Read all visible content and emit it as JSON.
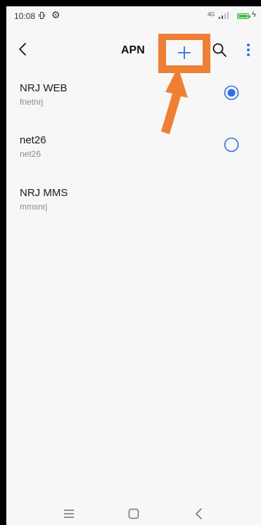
{
  "status_bar": {
    "time": "10:08",
    "network": "4G",
    "icons": [
      "vibrate-icon",
      "gear-icon",
      "signal-icon",
      "battery-icon",
      "charging-icon"
    ],
    "battery_color": "#37c43a"
  },
  "toolbar": {
    "title": "APN",
    "back_icon": "chevron-left-icon",
    "add_icon": "plus-icon",
    "search_icon": "search-icon",
    "more_icon": "more-vertical-icon",
    "highlight_color": "#ef7f35",
    "accent_color": "#2f6fe0"
  },
  "apns": [
    {
      "name": "NRJ WEB",
      "apn": "fnetnrj",
      "radio": "selected"
    },
    {
      "name": "net26",
      "apn": "net26",
      "radio": "unselected"
    },
    {
      "name": "NRJ MMS",
      "apn": "mmsnrj",
      "radio": "none"
    }
  ],
  "nav_bar": {
    "icons": [
      "menu-icon",
      "home-icon",
      "back-icon"
    ]
  }
}
